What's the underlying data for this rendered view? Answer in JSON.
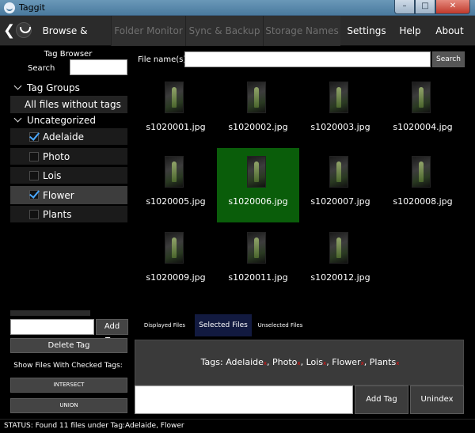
{
  "window": {
    "title": "Taggit",
    "controls": {
      "minimize": "–",
      "maximize": "□",
      "close": "✕"
    }
  },
  "menu": {
    "back_glyph": "❮",
    "items": [
      {
        "label": "Browse & Tag",
        "enabled": true
      },
      {
        "label": "Folder Monitor",
        "enabled": false
      },
      {
        "label": "Sync & Backup",
        "enabled": false
      },
      {
        "label": "Storage Names",
        "enabled": false
      },
      {
        "label": "Settings",
        "enabled": true
      },
      {
        "label": "Help",
        "enabled": true
      },
      {
        "label": "About",
        "enabled": true
      }
    ]
  },
  "sidebar": {
    "heading": "Tag Browser",
    "search_label": "Search",
    "tag_groups_label": "Tag Groups",
    "all_files_label": "All files without tags",
    "uncategorized_label": "Uncategorized",
    "tags": [
      {
        "label": "Adelaide",
        "checked": true,
        "selected": false
      },
      {
        "label": "Photo",
        "checked": false,
        "selected": false
      },
      {
        "label": "Lois",
        "checked": false,
        "selected": false
      },
      {
        "label": "Flower",
        "checked": true,
        "selected": true
      },
      {
        "label": "Plants",
        "checked": false,
        "selected": false
      }
    ],
    "add_tag_label": "Add Tag",
    "delete_tag_label": "Delete Tag",
    "show_files_label": "Show Files With Checked Tags:",
    "intersect_label": "INTERSECT",
    "union_label": "UNION"
  },
  "main": {
    "filename_label": "File name(s)",
    "search_button": "Search",
    "files": [
      {
        "name": "s1020001.jpg",
        "selected": false
      },
      {
        "name": "s1020002.jpg",
        "selected": false
      },
      {
        "name": "s1020003.jpg",
        "selected": false
      },
      {
        "name": "s1020004.jpg",
        "selected": false
      },
      {
        "name": "s1020005.jpg",
        "selected": false
      },
      {
        "name": "s1020006.jpg",
        "selected": true
      },
      {
        "name": "s1020007.jpg",
        "selected": false
      },
      {
        "name": "s1020008.jpg",
        "selected": false
      },
      {
        "name": "s1020009.jpg",
        "selected": false
      },
      {
        "name": "s1020011.jpg",
        "selected": false
      },
      {
        "name": "s1020012.jpg",
        "selected": false
      }
    ],
    "tabs": [
      {
        "label": "Displayed Files",
        "active": false
      },
      {
        "label": "Selected Files",
        "active": true
      },
      {
        "label": "Unselected Files",
        "active": false
      }
    ],
    "tags_prefix": "Tags:",
    "tag_chips": [
      "Adelaide",
      "Photo",
      "Lois",
      "Flower",
      "Plants"
    ],
    "tag_remove_glyph": "x",
    "add_tag_button": "Add Tag",
    "unindex_button": "Unindex"
  },
  "status": {
    "text": "STATUS: Found 11 files under Tag:Adelaide, Flower"
  },
  "colors": {
    "selected_file": "#0a5d0a",
    "active_tab": "#121a40",
    "check": "#4aa8ff",
    "remove_x": "#e11111"
  }
}
